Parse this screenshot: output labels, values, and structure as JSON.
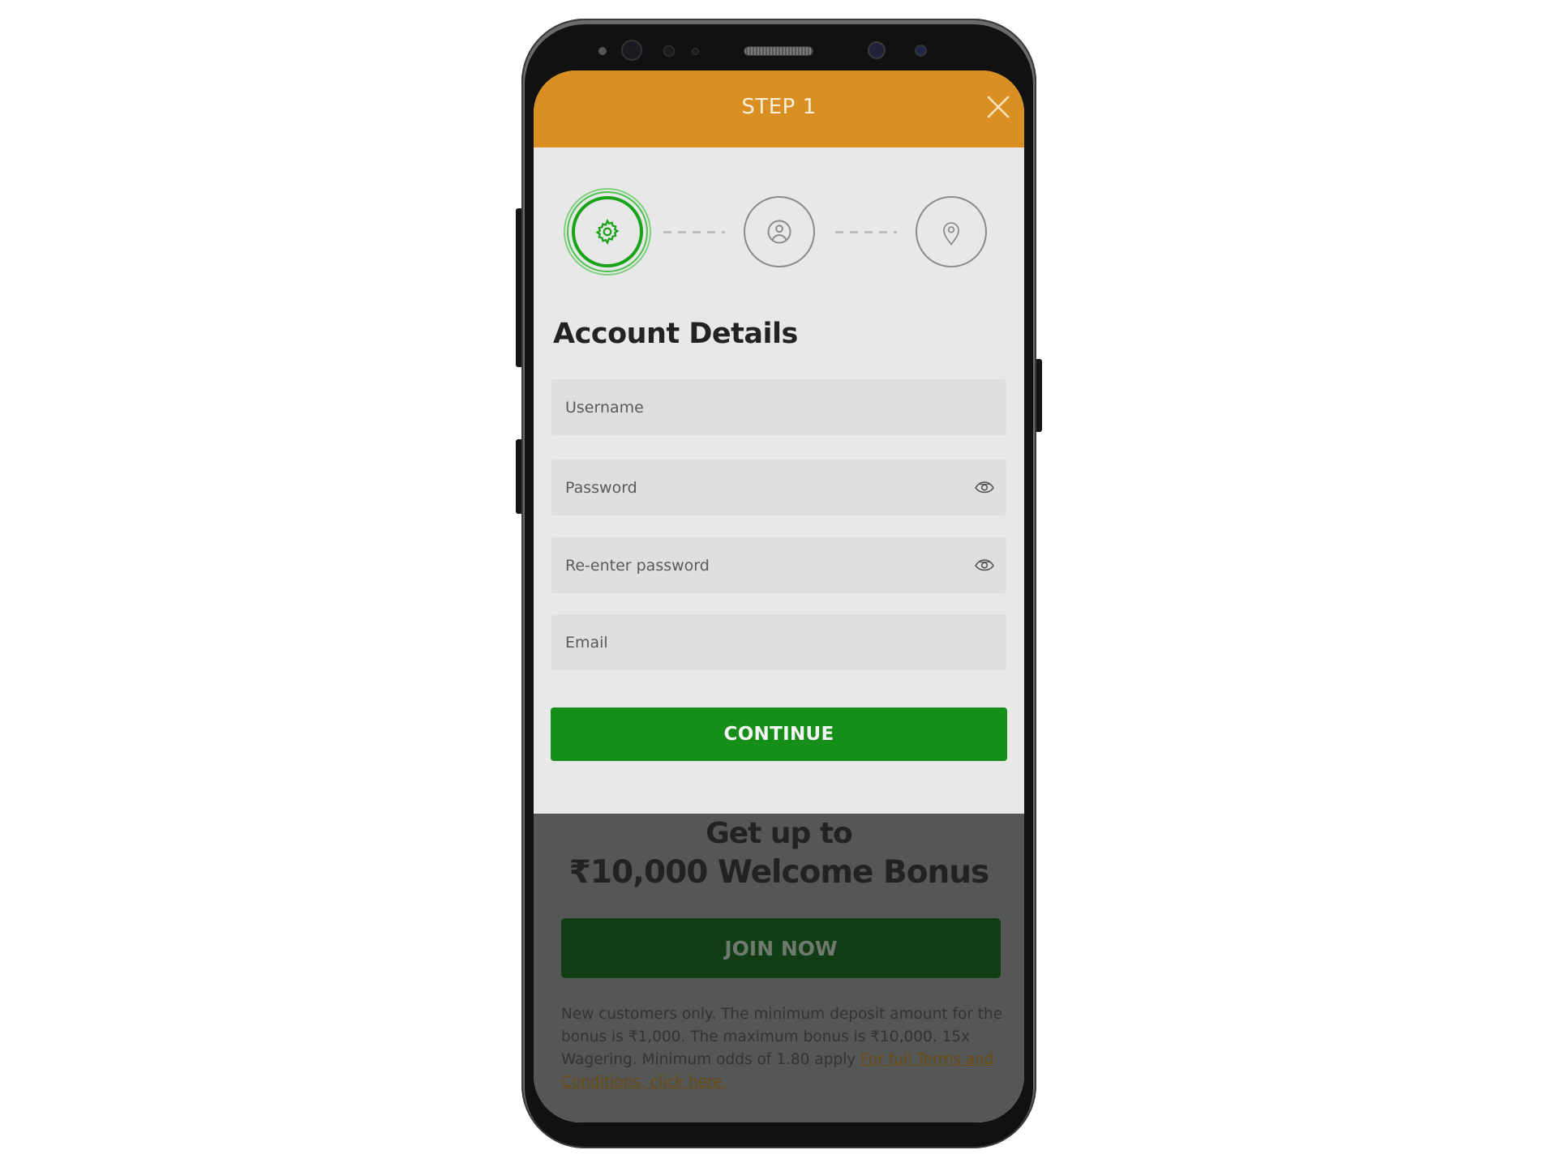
{
  "header": {
    "title": "STEP 1",
    "close_icon": "close-icon"
  },
  "colors": {
    "header_orange": "#d98f22",
    "primary_green": "#168f18",
    "active_step_green": "#18a318",
    "overlay_gray": "#555656"
  },
  "stepper": {
    "current_step": 1,
    "steps": [
      {
        "icon": "gear-icon",
        "state": "active"
      },
      {
        "icon": "user-circle-icon",
        "state": "inactive"
      },
      {
        "icon": "location-pin-icon",
        "state": "inactive"
      }
    ]
  },
  "form": {
    "title": "Account Details",
    "fields": [
      {
        "name": "username",
        "placeholder": "Username",
        "value": ""
      },
      {
        "name": "password",
        "placeholder": "Password",
        "value": "",
        "toggle_icon": "eye-icon"
      },
      {
        "name": "reenter_password",
        "placeholder": "Re-enter password",
        "value": "",
        "toggle_icon": "eye-icon"
      },
      {
        "name": "email",
        "placeholder": "Email",
        "value": ""
      }
    ],
    "continue_label": "CONTINUE"
  },
  "promo": {
    "line1": "Get up to",
    "line2": "₹10,000 Welcome Bonus",
    "join_label": "JOIN NOW",
    "terms_text": "New customers only. The minimum deposit amount for the bonus is ₹1,000. The maximum bonus is ₹10,000. 15x Wagering. Minimum odds of 1.80 apply ",
    "terms_link": "For full Terms and Conditions, click here."
  }
}
